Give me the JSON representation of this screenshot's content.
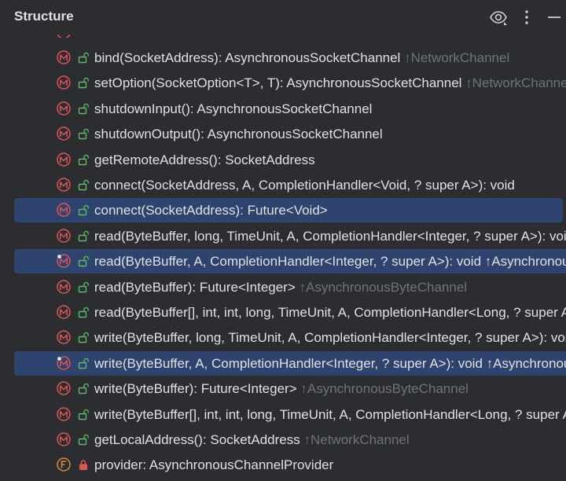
{
  "panel": {
    "title": "Structure",
    "eye_icon": "eye-icon",
    "more_icon": "more-vertical-icon",
    "minimize_icon": "minimize-icon"
  },
  "items": [
    {
      "text": "bind(SocketAddress): AsynchronousSocketChannel ",
      "inherited": "↑NetworkChannel",
      "icon": "method-icon",
      "visibility": "public-icon",
      "selected": false
    },
    {
      "text": "setOption(SocketOption<T>, T): AsynchronousSocketChannel ",
      "inherited": "↑NetworkChannel",
      "icon": "method-icon",
      "visibility": "public-icon",
      "selected": false
    },
    {
      "text": "shutdownInput(): AsynchronousSocketChannel",
      "inherited": "",
      "icon": "method-icon",
      "visibility": "public-icon",
      "selected": false
    },
    {
      "text": "shutdownOutput(): AsynchronousSocketChannel",
      "inherited": "",
      "icon": "method-icon",
      "visibility": "public-icon",
      "selected": false
    },
    {
      "text": "getRemoteAddress(): SocketAddress",
      "inherited": "",
      "icon": "method-icon",
      "visibility": "public-icon",
      "selected": false
    },
    {
      "text": "connect(SocketAddress, A, CompletionHandler<Void, ? super A>): void",
      "inherited": "",
      "icon": "method-icon",
      "visibility": "public-icon",
      "selected": false
    },
    {
      "text": "connect(SocketAddress): Future<Void>",
      "inherited": "",
      "icon": "method-icon",
      "visibility": "public-icon",
      "selected": true
    },
    {
      "text": "read(ByteBuffer, long, TimeUnit, A, CompletionHandler<Integer, ? super A>): void",
      "inherited": "",
      "icon": "method-icon",
      "visibility": "public-icon",
      "selected": false
    },
    {
      "text": "read(ByteBuffer, A, CompletionHandler<Integer, ? super A>): void ",
      "inherited": "↑AsynchronousByteChannel",
      "icon": "overriding-method-icon",
      "visibility": "public-icon",
      "selected": true
    },
    {
      "text": "read(ByteBuffer): Future<Integer> ",
      "inherited": "↑AsynchronousByteChannel",
      "icon": "method-icon",
      "visibility": "public-icon",
      "selected": false
    },
    {
      "text": "read(ByteBuffer[], int, int, long, TimeUnit, A, CompletionHandler<Long, ? super A>): void",
      "inherited": "",
      "icon": "method-icon",
      "visibility": "public-icon",
      "selected": false
    },
    {
      "text": "write(ByteBuffer, long, TimeUnit, A, CompletionHandler<Integer, ? super A>): void",
      "inherited": "",
      "icon": "method-icon",
      "visibility": "public-icon",
      "selected": false
    },
    {
      "text": "write(ByteBuffer, A, CompletionHandler<Integer, ? super A>): void ",
      "inherited": "↑AsynchronousByteChannel",
      "icon": "overriding-method-icon",
      "visibility": "public-icon",
      "selected": true
    },
    {
      "text": "write(ByteBuffer): Future<Integer> ",
      "inherited": "↑AsynchronousByteChannel",
      "icon": "method-icon",
      "visibility": "public-icon",
      "selected": false
    },
    {
      "text": "write(ByteBuffer[], int, int, long, TimeUnit, A, CompletionHandler<Long, ? super A>): void",
      "inherited": "",
      "icon": "method-icon",
      "visibility": "public-icon",
      "selected": false
    },
    {
      "text": "getLocalAddress(): SocketAddress ",
      "inherited": "↑NetworkChannel",
      "icon": "method-icon",
      "visibility": "public-icon",
      "selected": false
    },
    {
      "text": "provider: AsynchronousChannelProvider",
      "inherited": "",
      "icon": "field-icon",
      "visibility": "private-icon",
      "selected": false
    }
  ],
  "colors": {
    "background": "#2b2d30",
    "selection": "#2e436e",
    "method_icon": "#e05555",
    "field_icon": "#d98a3c",
    "public_icon": "#5fb865",
    "private_icon": "#e05555",
    "inherited_text": "#6f737a"
  }
}
